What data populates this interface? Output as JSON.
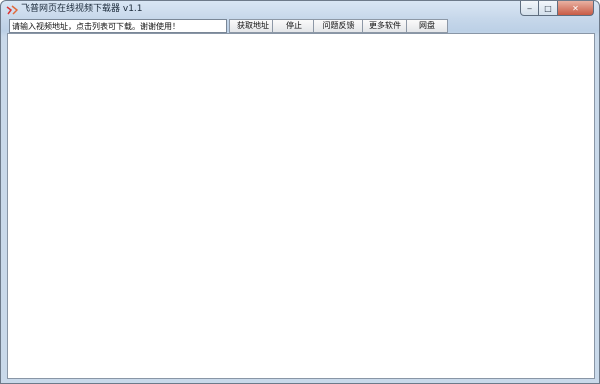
{
  "window": {
    "title": "飞普网页在线视频下载器 v1.1",
    "controls": {
      "minimize": "‒",
      "maximize": "□",
      "close": "✕"
    }
  },
  "toolbar": {
    "url_input_value": "请输入视频地址，点击列表可下载。谢谢使用！",
    "buttons": {
      "get_address": "获取地址",
      "stop": "停止",
      "feedback": "问题反馈",
      "more_software": "更多软件",
      "netdisk": "网盘"
    }
  },
  "icons": {
    "app": "app-logo-icon"
  },
  "colors": {
    "titlebar": "#c6d7ea",
    "close_button": "#c85b45",
    "content_bg": "#ffffff"
  }
}
